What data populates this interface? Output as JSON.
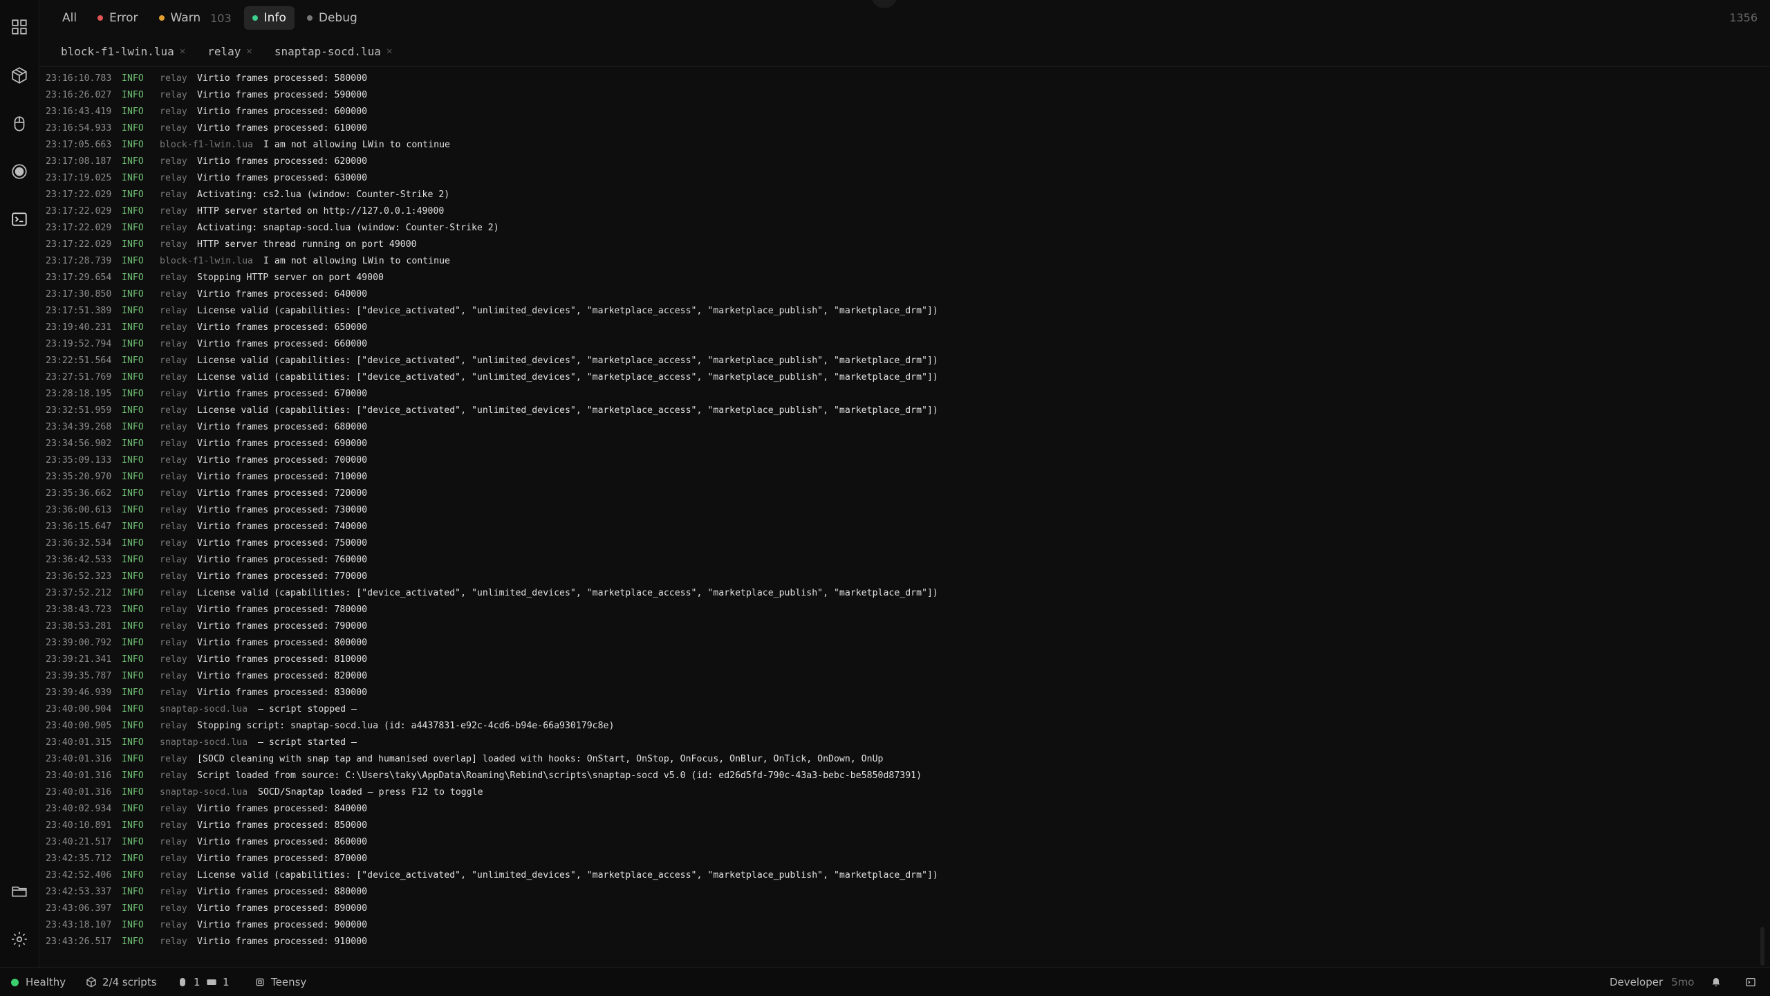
{
  "filters": {
    "all": "All",
    "error": "Error",
    "warn": "Warn",
    "warn_count": "103",
    "info": "Info",
    "debug": "Debug",
    "total_count": "1356",
    "colors": {
      "error": "#e05555",
      "warn": "#e0a030",
      "info": "#3ccf8e",
      "debug": "#777777"
    }
  },
  "source_tabs": [
    "block-f1-lwin.lua",
    "relay",
    "snaptap-socd.lua"
  ],
  "sidebar": {
    "icons": [
      "grid-icon",
      "package-icon",
      "mouse-icon",
      "record-icon",
      "terminal-icon",
      "folder-icon",
      "gear-icon"
    ]
  },
  "log": [
    {
      "ts": "23:16:10.783",
      "level": "INFO",
      "source": "relay",
      "msg": "Virtio frames processed: 580000"
    },
    {
      "ts": "23:16:26.027",
      "level": "INFO",
      "source": "relay",
      "msg": "Virtio frames processed: 590000"
    },
    {
      "ts": "23:16:43.419",
      "level": "INFO",
      "source": "relay",
      "msg": "Virtio frames processed: 600000"
    },
    {
      "ts": "23:16:54.933",
      "level": "INFO",
      "source": "relay",
      "msg": "Virtio frames processed: 610000"
    },
    {
      "ts": "23:17:05.663",
      "level": "INFO",
      "source": "block-f1-lwin.lua",
      "msg": "I am not allowing LWin to continue"
    },
    {
      "ts": "23:17:08.187",
      "level": "INFO",
      "source": "relay",
      "msg": "Virtio frames processed: 620000"
    },
    {
      "ts": "23:17:19.025",
      "level": "INFO",
      "source": "relay",
      "msg": "Virtio frames processed: 630000"
    },
    {
      "ts": "23:17:22.029",
      "level": "INFO",
      "source": "relay",
      "msg": "Activating: cs2.lua (window: Counter-Strike 2)"
    },
    {
      "ts": "23:17:22.029",
      "level": "INFO",
      "source": "relay",
      "msg": "HTTP server started on http://127.0.0.1:49000"
    },
    {
      "ts": "23:17:22.029",
      "level": "INFO",
      "source": "relay",
      "msg": "Activating: snaptap-socd.lua (window: Counter-Strike 2)"
    },
    {
      "ts": "23:17:22.029",
      "level": "INFO",
      "source": "relay",
      "msg": "HTTP server thread running on port 49000"
    },
    {
      "ts": "23:17:28.739",
      "level": "INFO",
      "source": "block-f1-lwin.lua",
      "msg": "I am not allowing LWin to continue"
    },
    {
      "ts": "23:17:29.654",
      "level": "INFO",
      "source": "relay",
      "msg": "Stopping HTTP server on port 49000"
    },
    {
      "ts": "23:17:30.850",
      "level": "INFO",
      "source": "relay",
      "msg": "Virtio frames processed: 640000"
    },
    {
      "ts": "23:17:51.389",
      "level": "INFO",
      "source": "relay",
      "msg": "License valid (capabilities: [\"device_activated\", \"unlimited_devices\", \"marketplace_access\", \"marketplace_publish\", \"marketplace_drm\"])"
    },
    {
      "ts": "23:19:40.231",
      "level": "INFO",
      "source": "relay",
      "msg": "Virtio frames processed: 650000"
    },
    {
      "ts": "23:19:52.794",
      "level": "INFO",
      "source": "relay",
      "msg": "Virtio frames processed: 660000"
    },
    {
      "ts": "23:22:51.564",
      "level": "INFO",
      "source": "relay",
      "msg": "License valid (capabilities: [\"device_activated\", \"unlimited_devices\", \"marketplace_access\", \"marketplace_publish\", \"marketplace_drm\"])"
    },
    {
      "ts": "23:27:51.769",
      "level": "INFO",
      "source": "relay",
      "msg": "License valid (capabilities: [\"device_activated\", \"unlimited_devices\", \"marketplace_access\", \"marketplace_publish\", \"marketplace_drm\"])"
    },
    {
      "ts": "23:28:18.195",
      "level": "INFO",
      "source": "relay",
      "msg": "Virtio frames processed: 670000"
    },
    {
      "ts": "23:32:51.959",
      "level": "INFO",
      "source": "relay",
      "msg": "License valid (capabilities: [\"device_activated\", \"unlimited_devices\", \"marketplace_access\", \"marketplace_publish\", \"marketplace_drm\"])"
    },
    {
      "ts": "23:34:39.268",
      "level": "INFO",
      "source": "relay",
      "msg": "Virtio frames processed: 680000"
    },
    {
      "ts": "23:34:56.902",
      "level": "INFO",
      "source": "relay",
      "msg": "Virtio frames processed: 690000"
    },
    {
      "ts": "23:35:09.133",
      "level": "INFO",
      "source": "relay",
      "msg": "Virtio frames processed: 700000"
    },
    {
      "ts": "23:35:20.970",
      "level": "INFO",
      "source": "relay",
      "msg": "Virtio frames processed: 710000"
    },
    {
      "ts": "23:35:36.662",
      "level": "INFO",
      "source": "relay",
      "msg": "Virtio frames processed: 720000"
    },
    {
      "ts": "23:36:00.613",
      "level": "INFO",
      "source": "relay",
      "msg": "Virtio frames processed: 730000"
    },
    {
      "ts": "23:36:15.647",
      "level": "INFO",
      "source": "relay",
      "msg": "Virtio frames processed: 740000"
    },
    {
      "ts": "23:36:32.534",
      "level": "INFO",
      "source": "relay",
      "msg": "Virtio frames processed: 750000"
    },
    {
      "ts": "23:36:42.533",
      "level": "INFO",
      "source": "relay",
      "msg": "Virtio frames processed: 760000"
    },
    {
      "ts": "23:36:52.323",
      "level": "INFO",
      "source": "relay",
      "msg": "Virtio frames processed: 770000"
    },
    {
      "ts": "23:37:52.212",
      "level": "INFO",
      "source": "relay",
      "msg": "License valid (capabilities: [\"device_activated\", \"unlimited_devices\", \"marketplace_access\", \"marketplace_publish\", \"marketplace_drm\"])"
    },
    {
      "ts": "23:38:43.723",
      "level": "INFO",
      "source": "relay",
      "msg": "Virtio frames processed: 780000"
    },
    {
      "ts": "23:38:53.281",
      "level": "INFO",
      "source": "relay",
      "msg": "Virtio frames processed: 790000"
    },
    {
      "ts": "23:39:00.792",
      "level": "INFO",
      "source": "relay",
      "msg": "Virtio frames processed: 800000"
    },
    {
      "ts": "23:39:21.341",
      "level": "INFO",
      "source": "relay",
      "msg": "Virtio frames processed: 810000"
    },
    {
      "ts": "23:39:35.787",
      "level": "INFO",
      "source": "relay",
      "msg": "Virtio frames processed: 820000"
    },
    {
      "ts": "23:39:46.939",
      "level": "INFO",
      "source": "relay",
      "msg": "Virtio frames processed: 830000"
    },
    {
      "ts": "23:40:00.904",
      "level": "INFO",
      "source": "snaptap-socd.lua",
      "msg": "— script stopped —"
    },
    {
      "ts": "23:40:00.905",
      "level": "INFO",
      "source": "relay",
      "msg": "Stopping script: snaptap-socd.lua (id: a4437831-e92c-4cd6-b94e-66a930179c8e)"
    },
    {
      "ts": "23:40:01.315",
      "level": "INFO",
      "source": "snaptap-socd.lua",
      "msg": "— script started —"
    },
    {
      "ts": "23:40:01.316",
      "level": "INFO",
      "source": "relay",
      "msg": "[SOCD cleaning with snap tap and humanised overlap] loaded with hooks: OnStart, OnStop, OnFocus, OnBlur, OnTick, OnDown, OnUp"
    },
    {
      "ts": "23:40:01.316",
      "level": "INFO",
      "source": "relay",
      "msg": "Script loaded from source: C:\\Users\\taky\\AppData\\Roaming\\Rebind\\scripts\\snaptap-socd v5.0 (id: ed26d5fd-790c-43a3-bebc-be5850d87391)"
    },
    {
      "ts": "23:40:01.316",
      "level": "INFO",
      "source": "snaptap-socd.lua",
      "msg": "SOCD/Snaptap loaded — press F12 to toggle"
    },
    {
      "ts": "23:40:02.934",
      "level": "INFO",
      "source": "relay",
      "msg": "Virtio frames processed: 840000"
    },
    {
      "ts": "23:40:10.891",
      "level": "INFO",
      "source": "relay",
      "msg": "Virtio frames processed: 850000"
    },
    {
      "ts": "23:40:21.517",
      "level": "INFO",
      "source": "relay",
      "msg": "Virtio frames processed: 860000"
    },
    {
      "ts": "23:42:35.712",
      "level": "INFO",
      "source": "relay",
      "msg": "Virtio frames processed: 870000"
    },
    {
      "ts": "23:42:52.406",
      "level": "INFO",
      "source": "relay",
      "msg": "License valid (capabilities: [\"device_activated\", \"unlimited_devices\", \"marketplace_access\", \"marketplace_publish\", \"marketplace_drm\"])"
    },
    {
      "ts": "23:42:53.337",
      "level": "INFO",
      "source": "relay",
      "msg": "Virtio frames processed: 880000"
    },
    {
      "ts": "23:43:06.397",
      "level": "INFO",
      "source": "relay",
      "msg": "Virtio frames processed: 890000"
    },
    {
      "ts": "23:43:18.107",
      "level": "INFO",
      "source": "relay",
      "msg": "Virtio frames processed: 900000"
    },
    {
      "ts": "23:43:26.517",
      "level": "INFO",
      "source": "relay",
      "msg": "Virtio frames processed: 910000"
    }
  ],
  "statusbar": {
    "health": "Healthy",
    "scripts": "2/4 scripts",
    "mouse_count": "1",
    "keyboard_count": "1",
    "device": "Teensy",
    "developer": "Developer",
    "developer_time": "5mo",
    "health_color": "#3ccf6e"
  }
}
